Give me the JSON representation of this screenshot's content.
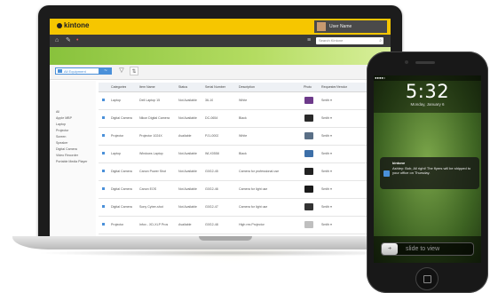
{
  "app": {
    "name": "kintone",
    "user_name": "User Name",
    "search_placeholder": "Search Kintone"
  },
  "view": {
    "selector_label": "All Equipment",
    "graph_label": "~",
    "filter_icon": "filter-icon",
    "option_icon": "options-icon"
  },
  "sidebar": {
    "items": [
      "All",
      "Apple MBP",
      "Laptop",
      "Projector",
      "Screen",
      "Speaker",
      "Digital Camera",
      "Video Recorder",
      "Portable Media Player"
    ]
  },
  "table": {
    "columns": [
      "Categories",
      "Item Name",
      "Status",
      "Serial Number",
      "Description",
      "Photo",
      "Requester/Vendor"
    ],
    "rows": [
      {
        "category": "Laptop",
        "item": "Dell Laptop 15",
        "status": "Not Available",
        "serial": "36-10",
        "description": "White",
        "requester": "Smith ▾",
        "photo_color": "#6d3a8a"
      },
      {
        "category": "Digital Camera",
        "item": "Nikon Digital Camera",
        "status": "Not Available",
        "serial": "DC-0654",
        "description": "Black",
        "requester": "Smith ▾",
        "photo_color": "#2a2a2a"
      },
      {
        "category": "Projector",
        "item": "Projector 1024X",
        "status": "Available",
        "serial": "PJ1-0002",
        "description": "White",
        "requester": "Smith ▾",
        "photo_color": "#5a6f86"
      },
      {
        "category": "Laptop",
        "item": "Windows Laptop",
        "status": "Not Available",
        "serial": "WLX0558",
        "description": "Black",
        "requester": "Smith ▾",
        "photo_color": "#3d6fa8"
      },
      {
        "category": "Digital Camera",
        "item": "Canon Power Shot",
        "status": "Not Available",
        "serial": "G0G2-45",
        "description": "Camera for professional use",
        "requester": "Smith ▾",
        "photo_color": "#222222"
      },
      {
        "category": "Digital Camera",
        "item": "Canon EOS",
        "status": "Not Available",
        "serial": "G0G2-46",
        "description": "Camera for light use",
        "requester": "Smith ▾",
        "photo_color": "#1a1a1a"
      },
      {
        "category": "Digital Camera",
        "item": "Sony Cyber-shot",
        "status": "Not Available",
        "serial": "G0G2-47",
        "description": "Camera for light use",
        "requester": "Smith ▾",
        "photo_color": "#333333"
      },
      {
        "category": "Projector",
        "item": "Infox - XD-XLP Pros",
        "status": "Available",
        "serial": "G0G2-48",
        "description": "High res Projector",
        "requester": "Smith ▾",
        "photo_color": "#bfbfbf"
      }
    ]
  },
  "phone": {
    "carrier": "●●●●○ ",
    "time": "5:32",
    "date": "Monday, January 6",
    "notification": {
      "title": "kintone",
      "text": "Ashley: Bob, All right! The flyers will be shipped to your office on Thursday."
    },
    "slide_label": "slide to view"
  }
}
